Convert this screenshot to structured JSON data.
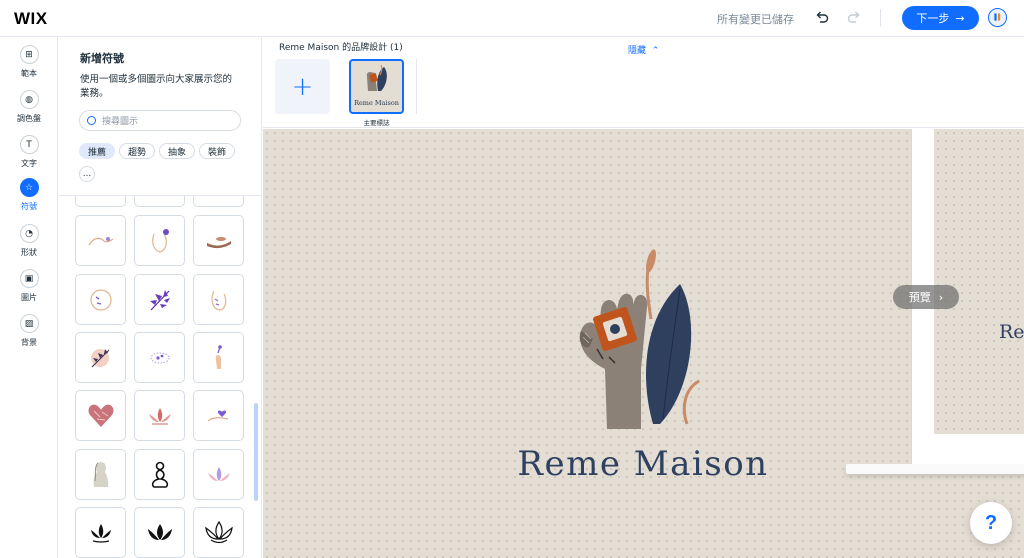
{
  "topbar": {
    "logo": "WIX",
    "saved_status": "所有變更已儲存",
    "next_label": "下一步",
    "next_arrow": "→",
    "icons": [
      "undo-icon",
      "redo-icon",
      "user-avatar-icon"
    ]
  },
  "rail": {
    "items": [
      {
        "label": "範本",
        "icon": "template-icon",
        "glyph": "⊞"
      },
      {
        "label": "調色盤",
        "icon": "palette-icon",
        "glyph": "◍"
      },
      {
        "label": "文字",
        "icon": "text-icon",
        "glyph": "T"
      },
      {
        "label": "符號",
        "icon": "star-icon",
        "glyph": "☆",
        "active": true
      },
      {
        "label": "形狀",
        "icon": "shapes-icon",
        "glyph": "◔"
      },
      {
        "label": "圖片",
        "icon": "image-icon",
        "glyph": "▣"
      },
      {
        "label": "背景",
        "icon": "background-icon",
        "glyph": "▨"
      }
    ]
  },
  "panel": {
    "title": "新增符號",
    "description": "使用一個或多個圖示向大家展示您的業務。",
    "search_placeholder": "搜尋圖示",
    "chips": [
      {
        "label": "推薦",
        "active": true
      },
      {
        "label": "趨勢"
      },
      {
        "label": "抽象"
      },
      {
        "label": "裝飾"
      },
      {
        "label": "..."
      }
    ],
    "tiles": [
      "hand-line-icon",
      "face-line-icon",
      "hand-dish-icon",
      "moon-face-icon",
      "purple-leaf-icon",
      "face-leaves-icon",
      "pink-leaf-circle-icon",
      "dotted-leaf-icon",
      "hand-flower-icon",
      "heart-icon",
      "lotus-red-icon",
      "hand-heart-icon",
      "woman-bust-icon",
      "woman-sitting-icon",
      "lotus-purple-icon",
      "lotus-black-icon",
      "lotus-solid-icon",
      "lotus-outline-icon"
    ]
  },
  "strip": {
    "title": "Reme Maison 的品牌設計 (1)",
    "hide_label": "隱藏",
    "main_logo_caption": "主要標誌",
    "main_logo_name": "Reme Maison"
  },
  "canvas": {
    "brand_name": "Reme Maison",
    "frame_text": "Re",
    "preview_label": "預覽",
    "help_label": "?",
    "colors": {
      "background": "#e3ddd3",
      "navy": "#2f4160",
      "orange": "#c0541d",
      "leaf": "#2f3f5e",
      "stem": "#c98b68",
      "hand": "#8c8177"
    }
  }
}
